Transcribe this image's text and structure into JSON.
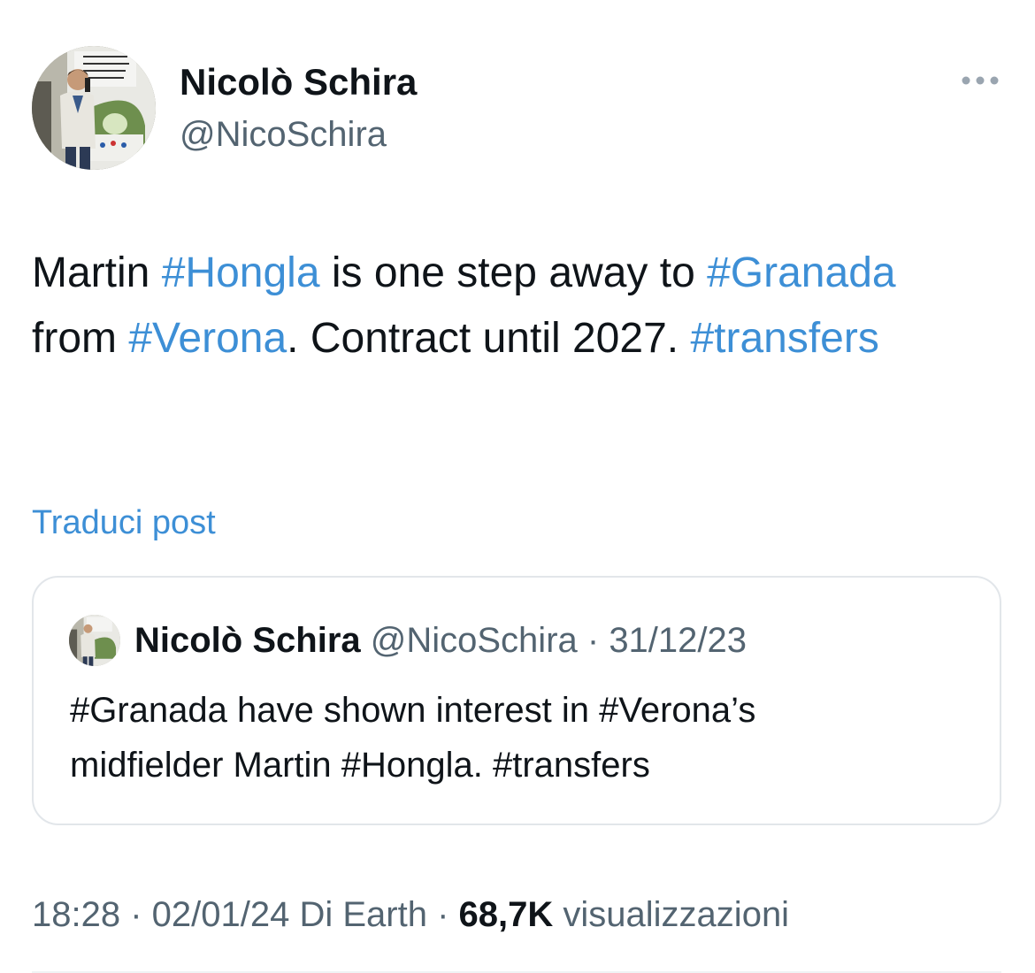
{
  "author": {
    "display_name": "Nicolò Schira",
    "handle": "@NicoSchira",
    "avatar_icon": "profile-photo"
  },
  "tweet": {
    "text_part_1": "Martin ",
    "tag_hongla": "#Hongla",
    "text_part_2": " is one step away to ",
    "tag_granada": "#Granada",
    "text_part_3": " from ",
    "tag_verona": "#Verona",
    "text_part_4": ". Contract until 2027. ",
    "tag_transfers": "#transfers",
    "translate_label": "Traduci post"
  },
  "quoted_tweet": {
    "display_name": "Nicolò Schira",
    "handle": "@NicoSchira",
    "separator": " · ",
    "date": "31/12/23",
    "text_line_1": "#Granada have shown interest in #Verona’s",
    "text_line_2": "midfielder Martin #Hongla. #transfers"
  },
  "footer": {
    "time": "18:28",
    "separator": " · ",
    "date": "02/01/24",
    "source": "Di Earth",
    "views_count": "68,7K",
    "views_label": "visualizzazioni"
  },
  "colors": {
    "link": "#3d8fd6",
    "secondary_text": "#536471",
    "primary_text": "#0f1419",
    "border": "#e2e6ea"
  }
}
